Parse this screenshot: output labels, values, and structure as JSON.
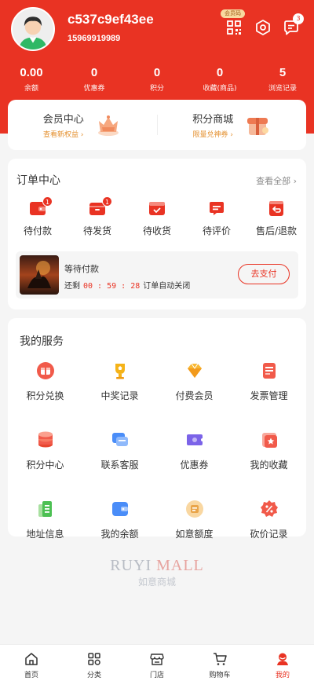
{
  "user": {
    "name": "c537c9ef43ee",
    "phone": "15969919989",
    "vip_tag": "会员码",
    "msg_count": "3"
  },
  "stats": [
    {
      "value": "0.00",
      "label": "余额"
    },
    {
      "value": "0",
      "label": "优惠券"
    },
    {
      "value": "0",
      "label": "积分"
    },
    {
      "value": "0",
      "label": "收藏(商品)"
    },
    {
      "value": "5",
      "label": "浏览记录"
    }
  ],
  "vip": {
    "center_title": "会员中心",
    "center_sub": "查看新权益 ›",
    "mall_title": "积分商城",
    "mall_sub": "限量兑神券 ›"
  },
  "orders": {
    "title": "订单中心",
    "see_all": "查看全部 ›",
    "items": [
      {
        "label": "待付款",
        "badge": "1"
      },
      {
        "label": "待发货",
        "badge": "1"
      },
      {
        "label": "待收货",
        "badge": ""
      },
      {
        "label": "待评价",
        "badge": ""
      },
      {
        "label": "售后/退款",
        "badge": ""
      }
    ],
    "pending": {
      "title": "等待付款",
      "prefix": "还剩",
      "countdown": "00 : 59 : 28",
      "suffix": "订单自动关闭",
      "button": "去支付"
    }
  },
  "services": {
    "title": "我的服务",
    "items": [
      {
        "label": "积分兑换",
        "icon": "points-exchange-icon"
      },
      {
        "label": "中奖记录",
        "icon": "trophy-icon"
      },
      {
        "label": "付费会员",
        "icon": "diamond-icon"
      },
      {
        "label": "发票管理",
        "icon": "invoice-icon"
      },
      {
        "label": "积分中心",
        "icon": "coin-stack-icon"
      },
      {
        "label": "联系客服",
        "icon": "chat-icon"
      },
      {
        "label": "优惠券",
        "icon": "coupon-icon"
      },
      {
        "label": "我的收藏",
        "icon": "favorite-icon"
      },
      {
        "label": "地址信息",
        "icon": "address-icon"
      },
      {
        "label": "我的余额",
        "icon": "wallet-icon"
      },
      {
        "label": "如意额度",
        "icon": "credit-icon"
      },
      {
        "label": "砍价记录",
        "icon": "bargain-icon"
      }
    ]
  },
  "brand": {
    "en_1": "RUYI",
    "en_2": "MALL",
    "cn": "如意商城"
  },
  "tabbar": [
    {
      "label": "首页",
      "icon": "home-icon"
    },
    {
      "label": "分类",
      "icon": "category-icon"
    },
    {
      "label": "门店",
      "icon": "store-icon"
    },
    {
      "label": "购物车",
      "icon": "cart-icon"
    },
    {
      "label": "我的",
      "icon": "profile-icon",
      "active": true
    }
  ],
  "colors": {
    "primary": "#e93323",
    "accent_gold": "#e4902f"
  }
}
